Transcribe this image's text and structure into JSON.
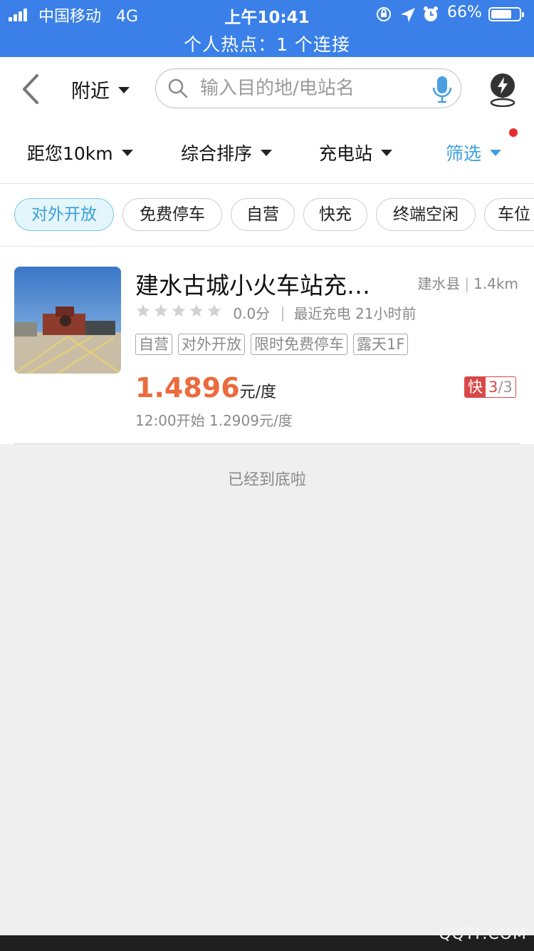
{
  "status_bar": {
    "carrier": "中国移动",
    "network": "4G",
    "time": "上午10:41",
    "battery": "66%",
    "hotspot": "个人热点：1 个连接"
  },
  "nav": {
    "location": "附近",
    "search_placeholder": "输入目的地/电站名"
  },
  "filters": [
    {
      "label": "距您10km"
    },
    {
      "label": "综合排序"
    },
    {
      "label": "充电站"
    },
    {
      "label": "筛选"
    }
  ],
  "chips": [
    {
      "label": "对外开放",
      "active": true
    },
    {
      "label": "免费停车"
    },
    {
      "label": "自营"
    },
    {
      "label": "快充"
    },
    {
      "label": "终端空闲"
    },
    {
      "label": "车位"
    }
  ],
  "station": {
    "name": "建水古城小火车站充…",
    "district": "建水县",
    "distance": "1.4km",
    "score": "0.0分",
    "last_charge": "最近充电 21小时前",
    "tags": [
      "自营",
      "对外开放",
      "限时免费停车",
      "露天1F"
    ],
    "price": "1.4896",
    "price_unit": "元/度",
    "next_price": "12:00开始 1.2909元/度",
    "fast_label": "快",
    "fast_available": "3",
    "fast_total": "/3",
    "rating_stars": 0
  },
  "end_text": "已经到底啦",
  "watermark": "QQTF.COM",
  "colors": {
    "status_bar": "#3a80e8",
    "accent_blue": "#3f9fde",
    "price_orange": "#ec6a3d",
    "fast_red": "#d94848"
  }
}
